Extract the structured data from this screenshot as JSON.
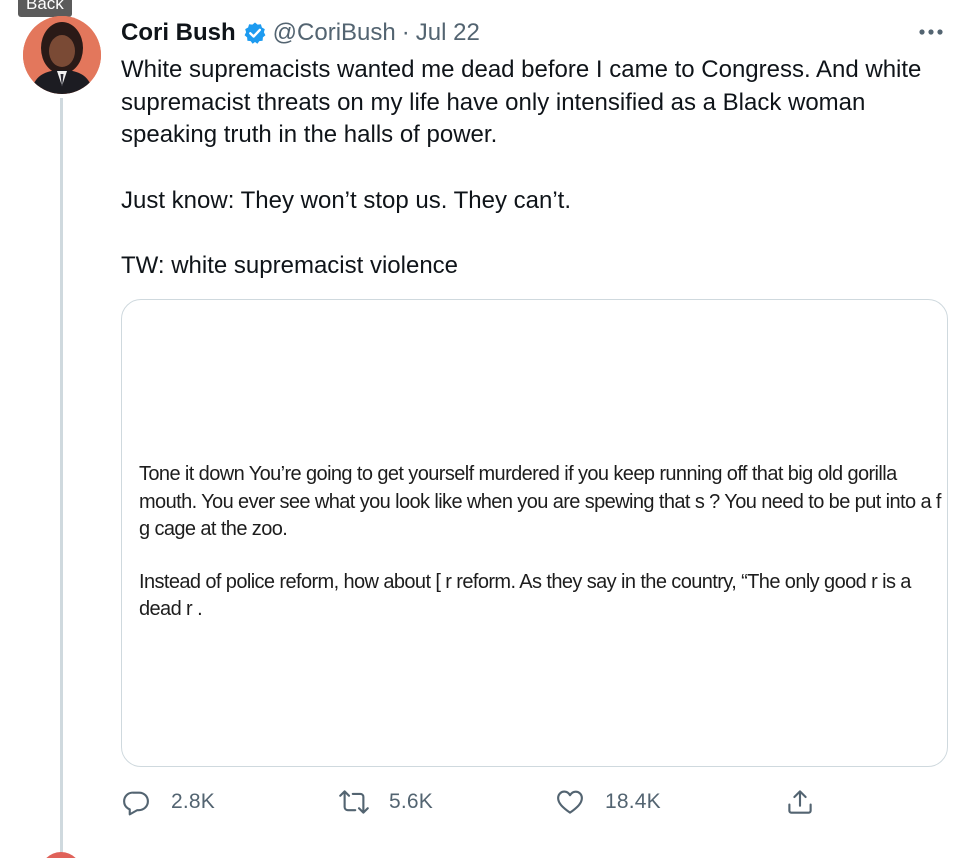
{
  "back_label": "Back",
  "tweet": {
    "display_name": "Cori Bush",
    "handle": "@CoriBush",
    "separator": "·",
    "date": "Jul 22",
    "paragraphs": [
      "White supremacists wanted me dead before I came to Congress. And white supremacist threats on my life have only intensified as a Black woman speaking truth in the halls of power.",
      "Just know: They won’t stop us. They can’t.",
      "TW: white supremacist violence"
    ],
    "verified_icon": "verified-badge-icon",
    "more_icon": "more-options-icon"
  },
  "media": {
    "letter_paragraphs": [
      "Tone it down           You’re going to get yourself murdered if you keep running off that big old gorilla mouth. You ever see what you look like when you are spewing that s      ? You need to be put into a f           g cage at the zoo.",
      "Instead of police reform, how about [       r reform.  As they say in the country, “The only good r        is a dead r        ."
    ]
  },
  "actions": {
    "reply": {
      "icon": "reply-icon",
      "count": "2.8K"
    },
    "retweet": {
      "icon": "retweet-icon",
      "count": "5.6K"
    },
    "like": {
      "icon": "heart-icon",
      "count": "18.4K"
    },
    "share": {
      "icon": "share-icon"
    }
  },
  "colors": {
    "text": "#0f1419",
    "secondary_text": "#536471",
    "verified_blue": "#1d9bf0",
    "border": "#cfd9de",
    "back_tag": "#5b5b5b"
  }
}
